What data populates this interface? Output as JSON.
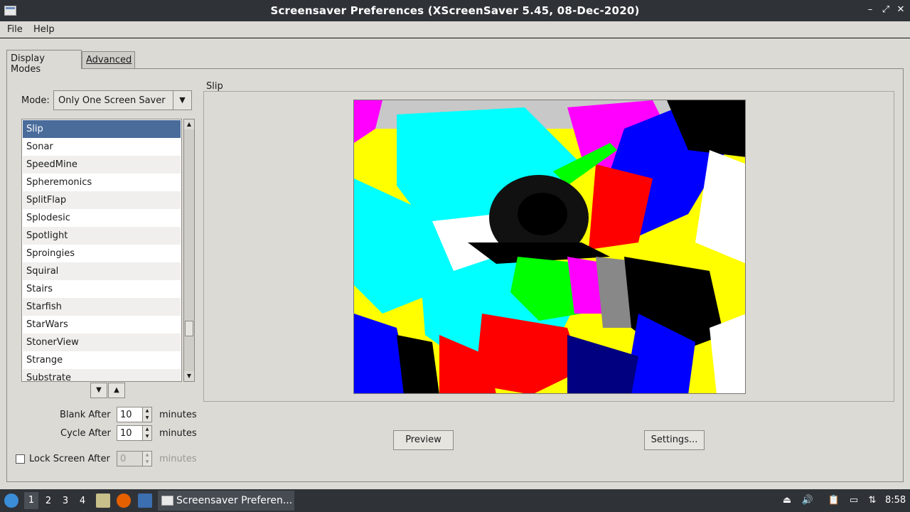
{
  "window": {
    "title": "Screensaver Preferences  (XScreenSaver 5.45, 08-Dec-2020)",
    "min": "–",
    "max": "⤢",
    "close": "✕"
  },
  "menubar": {
    "file": "File",
    "help": "Help"
  },
  "tabs": {
    "display_modes": "Display Modes",
    "advanced": "Advanced"
  },
  "mode": {
    "label": "Mode:",
    "value": "Only One Screen Saver"
  },
  "list": {
    "items": [
      "Slip",
      "Sonar",
      "SpeedMine",
      "Spheremonics",
      "SplitFlap",
      "Splodesic",
      "Spotlight",
      "Sproingies",
      "Squiral",
      "Stairs",
      "Starfish",
      "StarWars",
      "StonerView",
      "Strange",
      "Substrate"
    ],
    "selected_index": 0
  },
  "settings": {
    "blank_after_label": "Blank After",
    "blank_after_value": "10",
    "cycle_after_label": "Cycle After",
    "cycle_after_value": "10",
    "lock_label": "Lock Screen After",
    "lock_value": "0",
    "lock_checked": false,
    "minutes": "minutes"
  },
  "preview_frame": {
    "label": "Slip"
  },
  "buttons": {
    "preview": "Preview",
    "settings": "Settings..."
  },
  "taskbar": {
    "workspaces": [
      "1",
      "2",
      "3",
      "4"
    ],
    "active_workspace": "1",
    "task_label": "Screensaver Preferen...",
    "clock": "8:58"
  },
  "colors": {
    "titlebar_bg": "#2f3338",
    "selection": "#4a6c9b",
    "window_bg": "#dcdad5"
  }
}
